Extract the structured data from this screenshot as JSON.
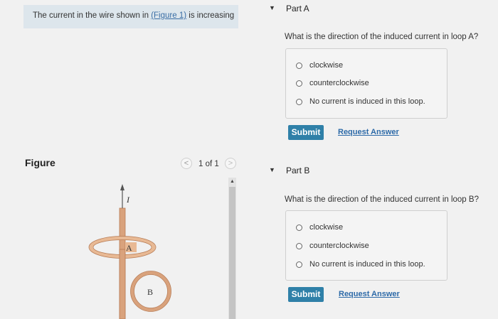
{
  "intro": {
    "text_before": "The current in the wire shown in ",
    "figure_link": "(Figure 1)",
    "text_after": " is increasing"
  },
  "figure": {
    "label": "Figure",
    "pager": "1 of 1",
    "prev_glyph": "<",
    "next_glyph": ">",
    "scroll_up_glyph": "▲",
    "current_label": "I",
    "loop_a_label": "A",
    "loop_b_label": "B"
  },
  "part_a": {
    "title": "Part A",
    "question": "What is the direction of the induced current in loop A?",
    "options": [
      "clockwise",
      "counterclockwise",
      "No current is induced in this loop."
    ],
    "submit": "Submit",
    "request": "Request Answer"
  },
  "part_b": {
    "title": "Part B",
    "question": "What is the direction of the induced current in loop B?",
    "options": [
      "clockwise",
      "counterclockwise",
      "No current is induced in this loop."
    ],
    "submit": "Submit",
    "request": "Request Answer"
  },
  "icons": {
    "collapse": "▼"
  },
  "colors": {
    "accent": "#2f80a8",
    "wire": "#d9a27c",
    "loop_a": "#e8b994",
    "loop_b": "#d9a27c"
  }
}
